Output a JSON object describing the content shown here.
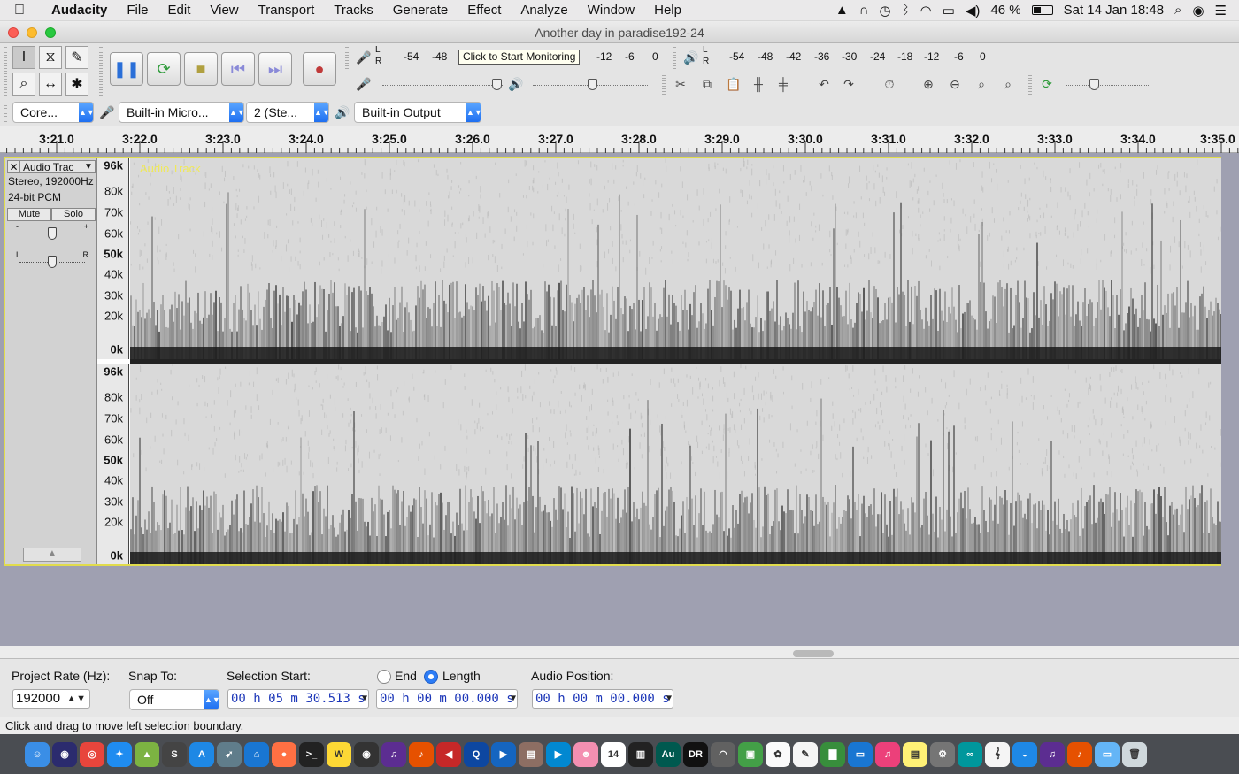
{
  "menubar": {
    "app_name": "Audacity",
    "items": [
      "File",
      "Edit",
      "View",
      "Transport",
      "Tracks",
      "Generate",
      "Effect",
      "Analyze",
      "Window",
      "Help"
    ],
    "battery_text": "46 %",
    "battery_level": 0.46,
    "clock": "Sat 14 Jan  18:48"
  },
  "window": {
    "title": "Another day in paradise192-24"
  },
  "meters": {
    "record_scale": [
      "-54",
      "-48",
      "-12",
      "-6",
      "0"
    ],
    "playback_scale": [
      "-54",
      "-48",
      "-42",
      "-36",
      "-30",
      "-24",
      "-18",
      "-12",
      "-6",
      "0"
    ],
    "tooltip": "Click to Start Monitoring",
    "lr_top": "L",
    "lr_bottom": "R"
  },
  "devices": {
    "host": "Core...",
    "input": "Built-in Micro...",
    "channels": "2 (Ste...",
    "output": "Built-in Output"
  },
  "ruler": {
    "labels": [
      "3:21.0",
      "3:22.0",
      "3:23.0",
      "3:24.0",
      "3:25.0",
      "3:26.0",
      "3:27.0",
      "3:28.0",
      "3:29.0",
      "3:30.0",
      "3:31.0",
      "3:32.0",
      "3:33.0",
      "3:34.0",
      "3:35.0"
    ]
  },
  "track": {
    "name": "Audio Trac",
    "close_glyph": "✕",
    "info_line1": "Stereo, 192000Hz",
    "info_line2": "24-bit PCM",
    "mute_label": "Mute",
    "solo_label": "Solo",
    "gain_minus": "-",
    "gain_plus": "+",
    "pan_left": "L",
    "pan_right": "R",
    "overlay_label": "Audio Track",
    "freq_labels_top": [
      "96k",
      "80k",
      "70k",
      "60k",
      "50k",
      "40k",
      "30k",
      "20k",
      "0k"
    ],
    "freq_labels_bottom": [
      "96k",
      "80k",
      "70k",
      "60k",
      "50k",
      "40k",
      "30k",
      "20k",
      "0k"
    ]
  },
  "selection_bar": {
    "project_rate_label": "Project Rate (Hz):",
    "project_rate_value": "192000",
    "snap_label": "Snap To:",
    "snap_value": "Off",
    "selection_start_label": "Selection Start:",
    "selection_start_value": "00 h 05 m 30.513 s",
    "end_label": "End",
    "length_label": "Length",
    "length_value": "00 h 00 m 00.000 s",
    "audio_position_label": "Audio Position:",
    "audio_position_value": "00 h 00 m 00.000 s"
  },
  "status": {
    "text": "Click and drag to move left selection boundary."
  },
  "dock": {
    "apps": [
      {
        "name": "finder",
        "color": "#3a8ee6",
        "glyph": "☺"
      },
      {
        "name": "siri",
        "color": "#2b2b6e",
        "glyph": "◉"
      },
      {
        "name": "chrome",
        "color": "#e8453c",
        "glyph": "◎"
      },
      {
        "name": "safari",
        "color": "#1f8cf0",
        "glyph": "✦"
      },
      {
        "name": "android-studio",
        "color": "#7cb342",
        "glyph": "▲"
      },
      {
        "name": "sublime",
        "color": "#444",
        "glyph": "S"
      },
      {
        "name": "app-store",
        "color": "#1e88e5",
        "glyph": "A"
      },
      {
        "name": "launchpad",
        "color": "#607d8b",
        "glyph": "➶"
      },
      {
        "name": "home",
        "color": "#1976d2",
        "glyph": "⌂"
      },
      {
        "name": "firefox",
        "color": "#ff7043",
        "glyph": "●"
      },
      {
        "name": "terminal",
        "color": "#222",
        "glyph": ">_"
      },
      {
        "name": "notes-app",
        "color": "#fdd835",
        "glyph": "W"
      },
      {
        "name": "vinyl",
        "color": "#333",
        "glyph": "◉"
      },
      {
        "name": "headphones",
        "color": "#5c2d91",
        "glyph": "♫"
      },
      {
        "name": "audacity",
        "color": "#e65100",
        "glyph": "♪"
      },
      {
        "name": "arrow-app",
        "color": "#c62828",
        "glyph": "◀"
      },
      {
        "name": "quicktime",
        "color": "#0d47a1",
        "glyph": "Q"
      },
      {
        "name": "player",
        "color": "#1565c0",
        "glyph": "▶"
      },
      {
        "name": "preview",
        "color": "#8d6e63",
        "glyph": "▤"
      },
      {
        "name": "media",
        "color": "#0288d1",
        "glyph": "▶"
      },
      {
        "name": "face",
        "color": "#f48fb1",
        "glyph": "☻"
      },
      {
        "name": "calendar",
        "color": "#ffffff",
        "glyph": "14"
      },
      {
        "name": "piano",
        "color": "#222",
        "glyph": "▥"
      },
      {
        "name": "audition",
        "color": "#00594f",
        "glyph": "Au"
      },
      {
        "name": "dynamic-range",
        "color": "#111",
        "glyph": "DR"
      },
      {
        "name": "ghost",
        "color": "#616161",
        "glyph": "◠"
      },
      {
        "name": "facetime",
        "color": "#43a047",
        "glyph": "▣"
      },
      {
        "name": "photos",
        "color": "#fafafa",
        "glyph": "✿"
      },
      {
        "name": "scripts",
        "color": "#f5f5f5",
        "glyph": "✎"
      },
      {
        "name": "numbers",
        "color": "#388e3c",
        "glyph": "▇"
      },
      {
        "name": "keynote",
        "color": "#1976d2",
        "glyph": "▭"
      },
      {
        "name": "itunes",
        "color": "#ec407a",
        "glyph": "♫"
      },
      {
        "name": "stickies",
        "color": "#fff176",
        "glyph": "▤"
      },
      {
        "name": "sys-prefs",
        "color": "#757575",
        "glyph": "⚙"
      },
      {
        "name": "arduino",
        "color": "#00979c",
        "glyph": "∞"
      },
      {
        "name": "musescore",
        "color": "#f5f5f5",
        "glyph": "𝄞"
      },
      {
        "name": "sync",
        "color": "#1e88e5",
        "glyph": "◒"
      },
      {
        "name": "headphones-2",
        "color": "#5c2d91",
        "glyph": "♫"
      },
      {
        "name": "audacity-2",
        "color": "#e65100",
        "glyph": "♪"
      },
      {
        "name": "folder",
        "color": "#64b5f6",
        "glyph": "▭"
      },
      {
        "name": "trash",
        "color": "#cfd8dc",
        "glyph": "🗑"
      }
    ]
  }
}
